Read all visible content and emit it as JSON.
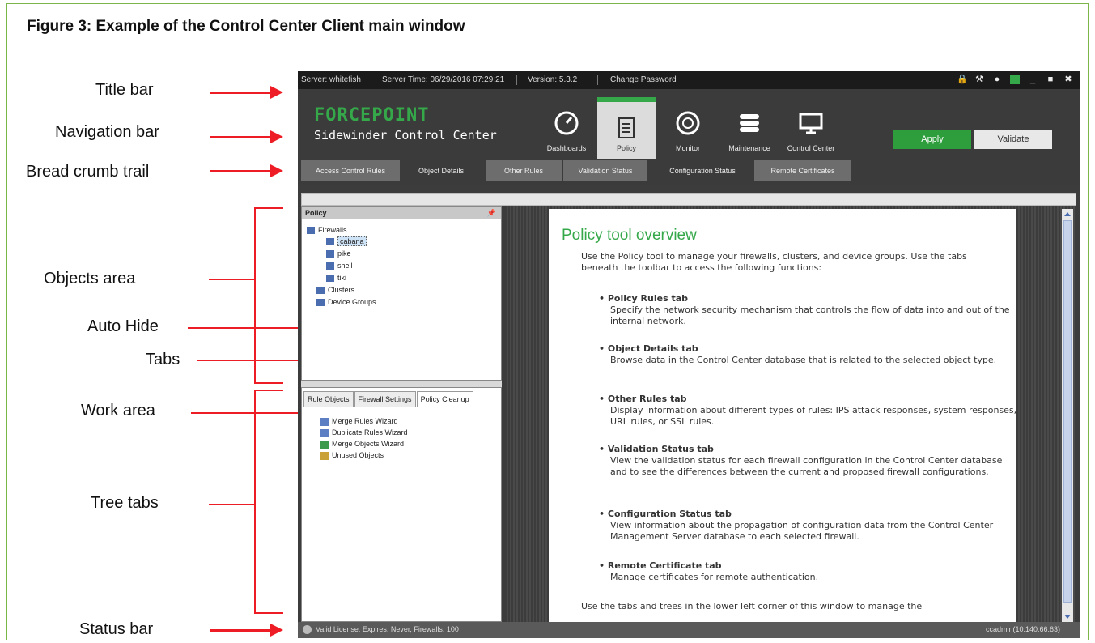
{
  "figure": {
    "title": "Figure 3: Example of the Control Center Client main window"
  },
  "callouts": {
    "title_bar": "Title bar",
    "navigation_bar": "Navigation bar",
    "bread_crumb_trail": "Bread crumb trail",
    "objects_area": "Objects area",
    "auto_hide": "Auto Hide",
    "tabs": "Tabs",
    "work_area": "Work area",
    "tree_tabs": "Tree tabs",
    "status_bar": "Status bar"
  },
  "app": {
    "titlebar": {
      "server": "Server: whitefish",
      "server_time": "Server Time: 06/29/2016 07:29:21",
      "version": "Version: 5.3.2",
      "change_password": "Change Password"
    },
    "brand": {
      "line1": "FORCEPOINT",
      "line2": "Sidewinder Control Center"
    },
    "nav": [
      "Dashboards",
      "Policy",
      "Monitor",
      "Maintenance",
      "Control Center"
    ],
    "apply": "Apply",
    "validate": "Validate",
    "crumbs": [
      "Access Control Rules",
      "Object Details",
      "Other Rules",
      "Validation Status",
      "Configuration Status",
      "Remote Certificates"
    ],
    "objects": {
      "header": "Policy",
      "tree": [
        "Firewalls",
        "cabana",
        "pike",
        "shell",
        "tiki",
        "Clusters",
        "Device Groups"
      ]
    },
    "tree_tabs": [
      "Rule Objects",
      "Firewall Settings",
      "Policy Cleanup"
    ],
    "work_items": [
      "Merge Rules Wizard",
      "Duplicate Rules Wizard",
      "Merge Objects Wizard",
      "Unused Objects"
    ],
    "doc": {
      "heading": "Policy tool overview",
      "intro": "Use the Policy tool to manage your firewalls, clusters, and device groups. Use the tabs beneath the toolbar to access the following functions:",
      "sections": [
        {
          "title": "Policy Rules tab",
          "body": "Specify the network security mechanism that controls the flow of data into and out of the internal network."
        },
        {
          "title": "Object Details tab",
          "body": "Browse data in the Control Center database that is related to the selected object type."
        },
        {
          "title": "Other Rules tab",
          "body": "Display information about different types of rules: IPS attack responses, system responses, URL rules, or SSL rules."
        },
        {
          "title": "Validation Status tab",
          "body": "View the validation status for each firewall configuration in the Control Center database and to see the differences between the current and proposed firewall configurations."
        },
        {
          "title": "Configuration Status tab",
          "body": "View information about the propagation of configuration data from the Control Center Management Server database to each selected firewall."
        },
        {
          "title": "Remote Certificate tab",
          "body": "Manage certificates for remote authentication."
        }
      ],
      "footer": "Use the tabs and trees in the lower left corner of this window to manage the"
    },
    "status": {
      "left": "Valid License: Expires: Never, Firewalls: 100",
      "right": "ccadmin(10.140.66.63)"
    }
  },
  "colors": {
    "accent_green": "#35a84a",
    "arrow_red": "#ee1c24",
    "frame_green": "#7ab648"
  }
}
